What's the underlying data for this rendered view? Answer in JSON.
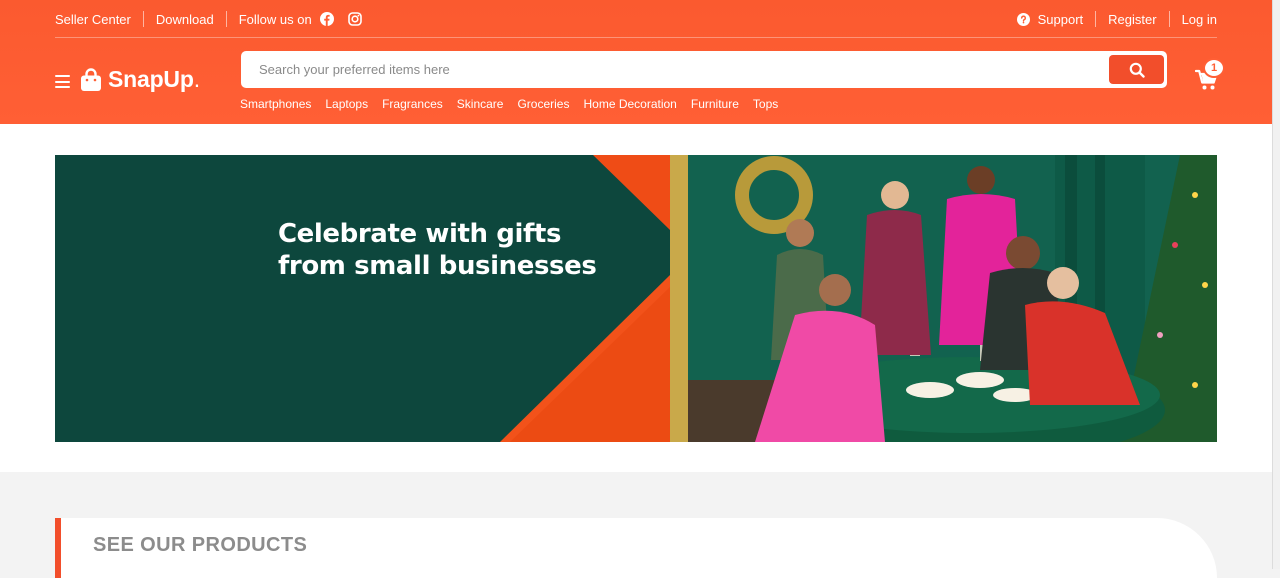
{
  "topbar": {
    "seller_center": "Seller Center",
    "download": "Download",
    "follow_us": "Follow us on",
    "support": "Support",
    "register": "Register",
    "login": "Log in"
  },
  "brand": {
    "name_bold": "SnapUp",
    "name_dot": "."
  },
  "search": {
    "placeholder": "Search your preferred items here",
    "value": ""
  },
  "categories": [
    "Smartphones",
    "Laptops",
    "Fragrances",
    "Skincare",
    "Groceries",
    "Home Decoration",
    "Furniture",
    "Tops"
  ],
  "cart": {
    "count": "1"
  },
  "banner": {
    "headline": "Celebrate with gifts from small businesses"
  },
  "products_section": {
    "title": "SEE OUR PRODUCTS"
  },
  "colors": {
    "primary": "#ff5f35",
    "accent_button": "#f24e2b",
    "banner_green": "#0d473d",
    "banner_orange": "#f04f14"
  },
  "icons": [
    "facebook-icon",
    "instagram-icon",
    "help-circle-icon",
    "menu-icon",
    "shopping-bag-icon",
    "search-icon",
    "cart-icon"
  ]
}
